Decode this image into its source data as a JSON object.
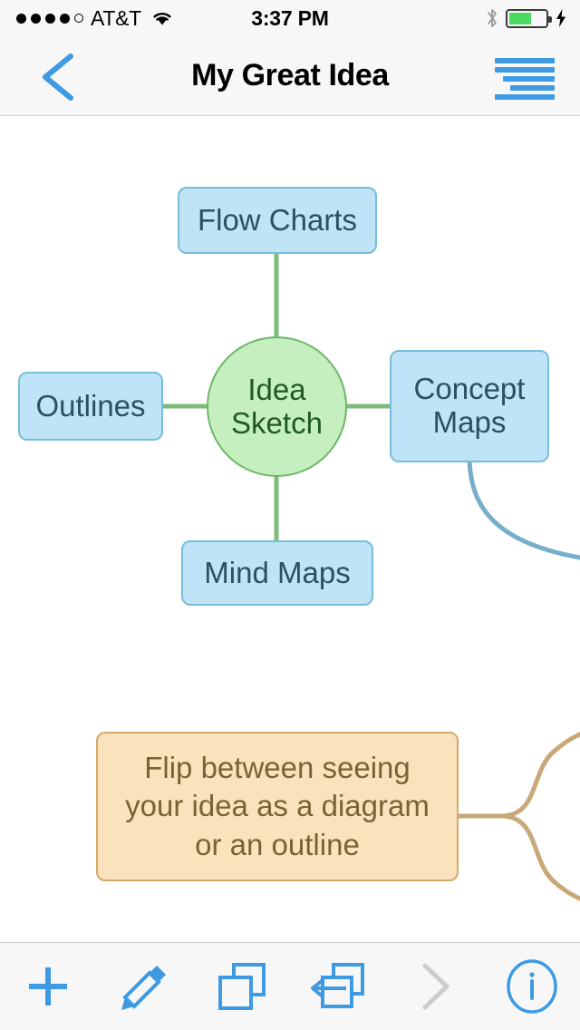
{
  "status_bar": {
    "signal_dots_filled": 4,
    "signal_dots_total": 5,
    "carrier": "AT&T",
    "wifi_icon": "wifi-icon",
    "time": "3:37 PM",
    "bluetooth_icon": "bluetooth-icon",
    "battery_level_percent": 62,
    "battery_color": "#4cd964",
    "charging_icon": "lightning-bolt-icon"
  },
  "nav_bar": {
    "back_icon": "chevron-left-icon",
    "title": "My Great Idea",
    "outline_icon": "outline-list-icon",
    "accent_color": "#3d9ae3"
  },
  "canvas": {
    "center_node": {
      "label_line1": "Idea",
      "label_line2": "Sketch",
      "fill": "#c6efc0",
      "border": "#6db768"
    },
    "nodes": [
      {
        "label": "Flow Charts",
        "fill": "#bfe4f7",
        "border": "#77bdd9"
      },
      {
        "label": "Outlines",
        "fill": "#bfe4f7",
        "border": "#77bdd9"
      },
      {
        "label_line1": "Concept",
        "label_line2": "Maps",
        "fill": "#bfe4f7",
        "border": "#77bdd9"
      },
      {
        "label": "Mind Maps",
        "fill": "#bfe4f7",
        "border": "#77bdd9"
      }
    ],
    "note": {
      "line1": "Flip between seeing",
      "line2": "your idea as a diagram",
      "line3": "or an outline",
      "fill": "#fae3bc",
      "border": "#d3a96c"
    },
    "connector_colors": {
      "center_links": "#7dbd78",
      "concept_branch": "#77aec9",
      "note_branch": "#c8a878"
    }
  },
  "toolbar": {
    "items": [
      {
        "icon": "plus-icon",
        "enabled": true
      },
      {
        "icon": "pencil-icon",
        "enabled": true
      },
      {
        "icon": "duplicate-icon",
        "enabled": true
      },
      {
        "icon": "extract-arrow-icon",
        "enabled": true
      },
      {
        "icon": "chevron-right-icon",
        "enabled": false
      },
      {
        "icon": "info-circle-icon",
        "enabled": true
      }
    ],
    "accent_color": "#3d9ae3",
    "disabled_color": "#cccccc"
  }
}
